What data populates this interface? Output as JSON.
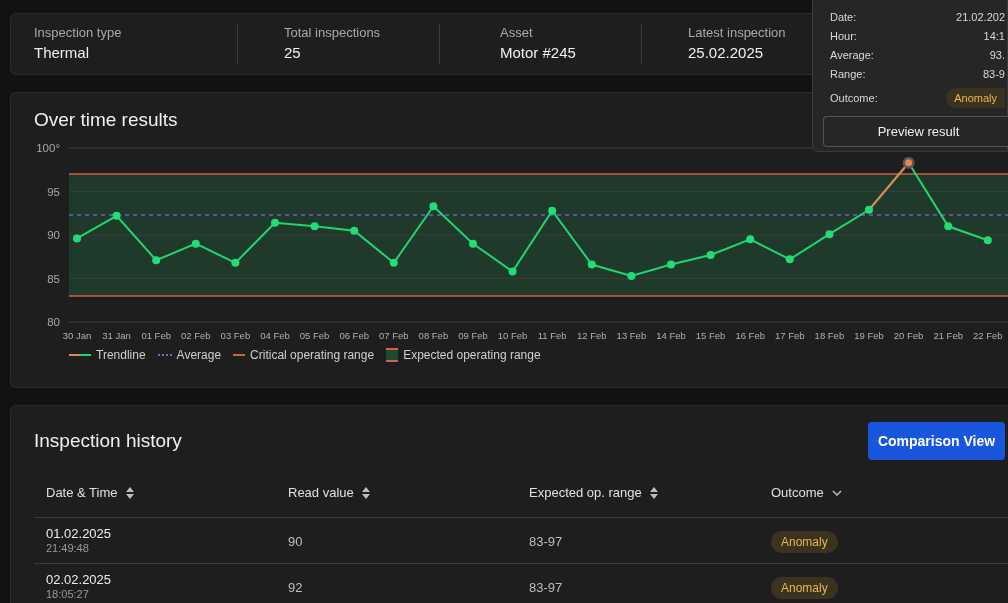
{
  "summary": [
    {
      "label": "Inspection type",
      "value": "Thermal"
    },
    {
      "label": "Total inspections",
      "value": "25"
    },
    {
      "label": "Asset",
      "value": "Motor #245"
    },
    {
      "label": "Latest inspection",
      "value": "25.02.2025"
    }
  ],
  "tooltip": {
    "rows": [
      {
        "label": "Date:",
        "value": "21.02.202"
      },
      {
        "label": "Hour:",
        "value": "14:1"
      },
      {
        "label": "Average:",
        "value": "93."
      },
      {
        "label": "Range:",
        "value": "83-9"
      }
    ],
    "outcome": {
      "label": "Outcome:",
      "badge": "Anomaly"
    },
    "button": "Preview result"
  },
  "chart": {
    "title": "Over time results",
    "chart_data": {
      "type": "line",
      "categories": [
        "30 Jan",
        "31 Jan",
        "01 Feb",
        "02 Feb",
        "03 Feb",
        "04 Feb",
        "05 Feb",
        "06 Feb",
        "07 Feb",
        "08 Feb",
        "09 Feb",
        "10 Feb",
        "11 Feb",
        "12 Feb",
        "13 Feb",
        "14 Feb",
        "15 Feb",
        "16 Feb",
        "17 Feb",
        "18 Feb",
        "19 Feb",
        "20 Feb",
        "21 Feb",
        "22 Feb"
      ],
      "series": [
        {
          "name": "Trendline",
          "color": "#22d46f",
          "marker": "o",
          "values": [
            89.6,
            92.2,
            87.1,
            89.0,
            86.8,
            91.4,
            91.0,
            90.5,
            86.8,
            93.3,
            89.0,
            85.8,
            92.8,
            86.6,
            85.3,
            86.6,
            87.7,
            89.5,
            87.2,
            90.1,
            92.9,
            98.3,
            91.0,
            89.4
          ]
        }
      ],
      "ylim": [
        80,
        100
      ],
      "yticks": [
        80,
        85,
        90,
        95,
        {
          "value": 100,
          "label": "100°"
        }
      ],
      "grid": true,
      "bands": [
        {
          "axis": "y",
          "from": 83,
          "to": 97,
          "color": "#1f3a2b"
        }
      ],
      "ref_lines": [
        {
          "axis": "y",
          "value": 97,
          "color": "#d0604a"
        },
        {
          "axis": "y",
          "value": 83,
          "color": "#d0604a"
        },
        {
          "axis": "y",
          "value": 92.3,
          "color": "#7a55c8"
        }
      ]
    },
    "points": [
      {
        "selected": false
      },
      {
        "selected": false
      },
      {
        "selected": false
      },
      {
        "selected": false
      },
      {
        "selected": false
      },
      {
        "selected": false
      },
      {
        "selected": false
      },
      {
        "selected": false
      },
      {
        "selected": false
      },
      {
        "selected": false
      },
      {
        "selected": false
      },
      {
        "selected": false
      },
      {
        "selected": false
      },
      {
        "selected": false
      },
      {
        "selected": false
      },
      {
        "selected": false
      },
      {
        "selected": false
      },
      {
        "selected": false
      },
      {
        "selected": false
      },
      {
        "selected": false
      },
      {
        "selected": false
      },
      {
        "selected": true
      },
      {
        "selected": false
      },
      {
        "selected": false
      }
    ],
    "legend": [
      {
        "kind": "average",
        "label": "Average"
      },
      {
        "kind": "critical",
        "label": "Critical operating range"
      },
      {
        "kind": "expected",
        "label": "Expected operating range"
      }
    ]
  },
  "history": {
    "title": "Inspection history",
    "button": "Comparison View",
    "columns": [
      {
        "label": "Date & Time",
        "kind": "sortable"
      },
      {
        "label": "Read value",
        "kind": "sortable"
      },
      {
        "label": "Expected op. range",
        "kind": "sortable"
      },
      {
        "label": "Outcome",
        "kind": "filter"
      }
    ],
    "rows": [
      {
        "date": "01.02.2025",
        "time": "21:49:48",
        "read": "90",
        "range": "83-97",
        "outcome": "Anomaly"
      },
      {
        "date": "02.02.2025",
        "time": "18:05:27",
        "read": "92",
        "range": "83-97",
        "outcome": "Anomaly"
      }
    ]
  }
}
